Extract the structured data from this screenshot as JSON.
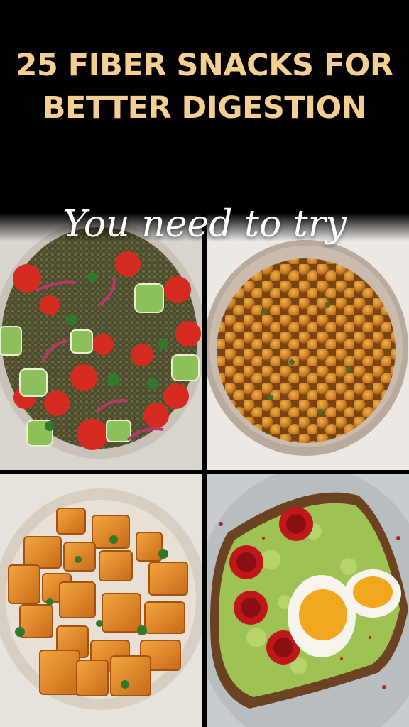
{
  "header": {
    "title_line1": "25 FIBER SNACKS FOR",
    "title_line2": "BETTER DIGESTION",
    "subtitle": "You need to try"
  },
  "colors": {
    "background": "#000000",
    "title": "#f5cf92",
    "subtitle": "#ffffff"
  },
  "photos": [
    {
      "name": "lentil-salad-photo"
    },
    {
      "name": "roasted-chickpeas-photo"
    },
    {
      "name": "roasted-squash-photo"
    },
    {
      "name": "avocado-toast-photo"
    }
  ]
}
